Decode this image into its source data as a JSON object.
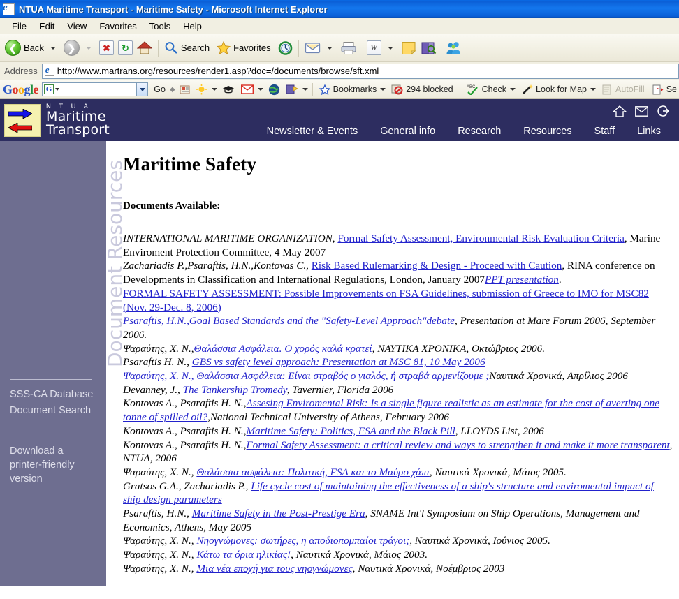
{
  "window": {
    "title": "NTUA Maritime Transport - Maritime Safety - Microsoft Internet Explorer",
    "app_icon": "internet-explorer-icon"
  },
  "menubar": [
    "File",
    "Edit",
    "View",
    "Favorites",
    "Tools",
    "Help"
  ],
  "toolbar": {
    "back": "Back",
    "search": "Search",
    "favorites": "Favorites"
  },
  "address": {
    "label": "Address",
    "url": "http://www.martrans.org/resources/render1.asp?doc=/documents/browse/sft.xml"
  },
  "google_toolbar": {
    "logo": "Google",
    "search_value": "",
    "go": "Go",
    "bookmarks": "Bookmarks",
    "blocked": "294 blocked",
    "check": "Check",
    "look_for_map": "Look for Map",
    "autofill": "AutoFill",
    "send_to": "Se"
  },
  "site": {
    "logo_top": "N T U A",
    "logo_line1": "Maritime",
    "logo_line2": "Transport",
    "nav": [
      "Newsletter & Events",
      "General info",
      "Research",
      "Resources",
      "Staff",
      "Links"
    ],
    "header_color": "#2d2d60",
    "sidebar_color": "#6e6e90"
  },
  "sidebar": {
    "vertical_label": "Document  Resources",
    "links": [
      "SSS-CA Database",
      "Document Search"
    ],
    "download_lines": [
      "Download a",
      "printer-friendly",
      "version"
    ]
  },
  "main": {
    "page_title": "Maritime Safety",
    "documents_available": "Documents Available:",
    "documents": [
      [
        {
          "t": "INTERNATIONAL MARITIME ORGANIZATION,",
          "s": "i"
        },
        {
          "t": " ",
          "s": "p"
        },
        {
          "t": "Formal Safety Assessment, Environmental Risk Evaluation Criteria",
          "s": "a"
        },
        {
          "t": ", Marine Enviroment Protection Committee, 4 May 2007",
          "s": "p"
        }
      ],
      [
        {
          "t": "Zachariadis P.,Psaraftis, H.N.,Kontovas C.,",
          "s": "i"
        },
        {
          "t": " ",
          "s": "p"
        },
        {
          "t": "Risk Based Rulemarking & Design - Proceed with Caution",
          "s": "a"
        },
        {
          "t": ", RINA conference on Developments in Classification and International Regulations, London, January 2007",
          "s": "p"
        },
        {
          "t": "PPT presentation",
          "s": "ai"
        },
        {
          "t": ".",
          "s": "p"
        }
      ],
      [
        {
          "t": "FORMAL SAFETY ASSESSMENT: Possible Improvements on FSA Guidelines, submission of Greece to IMO for MSC82 (Nov. 29-Dec. 8, 2006)",
          "s": "a"
        }
      ],
      [
        {
          "t": "Psaraftis, H.N.,Goal Based Standards and the \"Safety-Level Approach\"debate",
          "s": "ai"
        },
        {
          "t": ", ",
          "s": "p"
        },
        {
          "t": "Presentation at Mare Forum 2006, September 2006.",
          "s": "i"
        }
      ],
      [
        {
          "t": "Ψαραύτης, Χ. Ν.,",
          "s": "i"
        },
        {
          "t": "Θαλάσσια Ασφάλεια. Ο χορός καλά κρατεί",
          "s": "ai"
        },
        {
          "t": ", ΝΑΥΤΙΚΑ ΧΡΟΝΙΚΑ, Οκτώβριος 2006.",
          "s": "i"
        }
      ],
      [
        {
          "t": "Psaraftis H. N., ",
          "s": "i"
        },
        {
          "t": "GBS vs safety level approach: Presentation at MSC 81, 10 May 2006",
          "s": "ai"
        }
      ],
      [
        {
          "t": "Ψαραύτης, Χ. Ν., Θαλάσσια Ασφάλεια: Είναι στραβός ο γιαλός, ή στραβά αρμενίζουμε ;",
          "s": "ai"
        },
        {
          "t": "Ναυτικά Χρονικά, Απρίλιος 2006",
          "s": "i"
        }
      ],
      [
        {
          "t": "Devanney, J., ",
          "s": "i"
        },
        {
          "t": "The Tankership Tromedy",
          "s": "ai"
        },
        {
          "t": ", Tavernier, Florida 2006",
          "s": "i"
        }
      ],
      [
        {
          "t": "Kontovas A., Psaraftis H. N.,",
          "s": "i"
        },
        {
          "t": "Assesing Enviromental Risk: Is a single figure realistic as an estimate for the cost of averting one tonne of spilled oil?",
          "s": "ai"
        },
        {
          "t": ",National Technical University of Athens, February 2006",
          "s": "i"
        }
      ],
      [
        {
          "t": "Kontovas A., Psaraftis H. N.,",
          "s": "i"
        },
        {
          "t": "Maritime Safety: Politics, FSA and the Black Pill",
          "s": "ai"
        },
        {
          "t": ", LLOYDS List, 2006",
          "s": "i"
        }
      ],
      [
        {
          "t": "Kontovas A., Psaraftis H. N.,",
          "s": "i"
        },
        {
          "t": "Formal Safety Assessment: a critical review and ways to strengthen it and make it more transparent",
          "s": "ai"
        },
        {
          "t": ", NTUA, 2006",
          "s": "i"
        }
      ],
      [
        {
          "t": "Ψαραύτης, Χ. Ν., ",
          "s": "i"
        },
        {
          "t": "Θαλάσσια ασφάλεια: Πολιτική, FSA και το Μαύρο χάπι",
          "s": "ai"
        },
        {
          "t": ", Ναυτικά Χρονικά, Μάιος 2005.",
          "s": "i"
        }
      ],
      [
        {
          "t": "Gratsos G.A., Zachariadis P., ",
          "s": "i"
        },
        {
          "t": "Life cycle cost of maintaining the effectiveness of a ship's structure and enviromental impact of ship design parameters",
          "s": "ai"
        }
      ],
      [
        {
          "t": "Psaraftis, H.N., ",
          "s": "i"
        },
        {
          "t": "Maritime Safety in the Post-Prestige Era",
          "s": "ai"
        },
        {
          "t": ", SNAME Int'l Symposium on Ship Operations, Management and Economics, Athens, May 2005",
          "s": "i"
        }
      ],
      [
        {
          "t": "Ψαραύτης, Χ. Ν., ",
          "s": "i"
        },
        {
          "t": "Νηογνώμονες: σωτήρες, η αποδιοπομπαίοι τράγοι;",
          "s": "ai"
        },
        {
          "t": ", Ναυτικά Χρονικά, Ιούνιος 2005.",
          "s": "i"
        }
      ],
      [
        {
          "t": "Ψαραύτης, Χ. Ν., ",
          "s": "i"
        },
        {
          "t": "Κάτω τα όρια ηλικίας!",
          "s": "ai"
        },
        {
          "t": ", Ναυτικά Χρονικά, Μάιος 2003.",
          "s": "i"
        }
      ],
      [
        {
          "t": "Ψαραύτης, Χ. Ν., ",
          "s": "i"
        },
        {
          "t": "Μια νέα εποχή για τους νηογνώμονες",
          "s": "ai"
        },
        {
          "t": ", Ναυτικά Χρονικά, Νοέμβριος 2003",
          "s": "i"
        }
      ]
    ]
  }
}
